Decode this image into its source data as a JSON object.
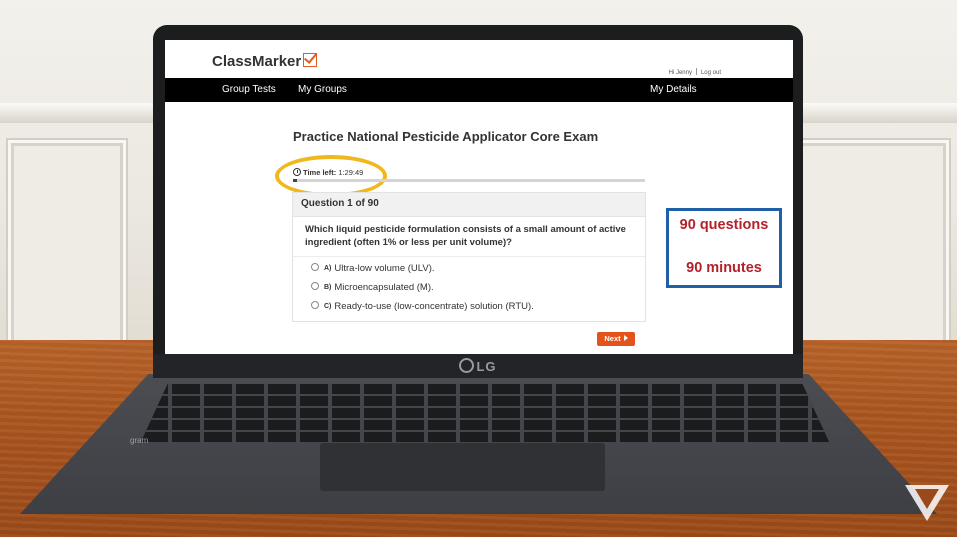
{
  "app": {
    "logo_text": "ClassMarker",
    "greeting": "Hi Jenny",
    "logout_label": "Log out"
  },
  "nav": {
    "items": [
      "Group Tests",
      "My Groups"
    ],
    "right_item": "My Details"
  },
  "exam": {
    "title": "Practice National Pesticide Applicator Core Exam",
    "timer_label": "Time left:",
    "timer_value": "1:29:49",
    "progress_fraction": 0.011
  },
  "question": {
    "header": "Question 1 of 90",
    "text": "Which liquid pesticide formulation consists of a small amount of active ingredient (often 1% or less per unit volume)?",
    "options": [
      {
        "letter": "A)",
        "text": "Ultra-low volume (ULV)."
      },
      {
        "letter": "B)",
        "text": "Microencapsulated (M)."
      },
      {
        "letter": "C)",
        "text": "Ready-to-use (low-concentrate) solution (RTU)."
      }
    ]
  },
  "next_button": "Next",
  "callout": {
    "line1": "90 questions",
    "line2": "90 minutes"
  },
  "device": {
    "brand": "LG",
    "model": "gram"
  },
  "colors": {
    "accent": "#e3541c",
    "nav_bg": "#000000",
    "callout_border": "#1f5fa8",
    "callout_text": "#b3212b",
    "highlight_ellipse": "#f0b81d"
  }
}
